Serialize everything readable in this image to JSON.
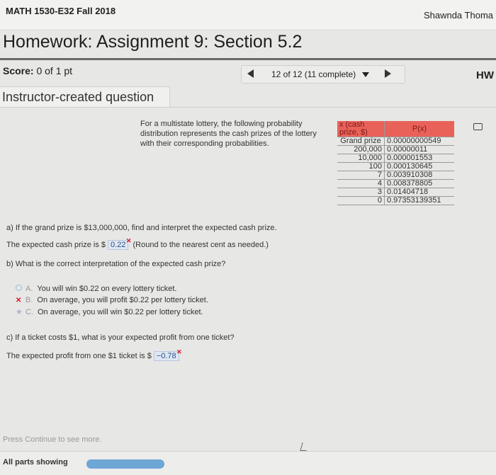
{
  "header": {
    "course": "MATH 1530-E32 Fall 2018",
    "user": "Shawnda Thoma"
  },
  "homework": {
    "title": "Homework: Assignment 9: Section 5.2",
    "score_label": "Score:",
    "score_value": "0 of 1 pt",
    "nav_text": "12 of 12 (11 complete)",
    "badge": "HW"
  },
  "question": {
    "type_label": "Instructor-created question",
    "prompt": "For a multistate lottery, the following probability distribution represents the cash prizes of the lottery with their corresponding probabilities.",
    "table": {
      "headers": [
        "x (cash prize, $)",
        "P(x)"
      ],
      "rows": [
        {
          "x": "Grand prize",
          "p": "0.00000000549"
        },
        {
          "x": "200,000",
          "p": "0.00000011"
        },
        {
          "x": "10,000",
          "p": "0.000001553"
        },
        {
          "x": "100",
          "p": "0.000130645"
        },
        {
          "x": "7",
          "p": "0.003910308"
        },
        {
          "x": "4",
          "p": "0.008378805"
        },
        {
          "x": "3",
          "p": "0.01404718"
        },
        {
          "x": "0",
          "p": "0.97353139351"
        }
      ]
    },
    "part_a": {
      "question": "a) If the grand prize is $13,000,000, find and interpret the expected cash prize.",
      "answer_prefix": "The expected cash prize is $",
      "answer_value": "0.22",
      "answer_suffix": "(Round to the nearest cent as needed.)"
    },
    "part_b": {
      "question": "b) What is the correct interpretation of the expected cash prize?",
      "choices": [
        {
          "letter": "A.",
          "text": "You will win $0.22 on every lottery ticket."
        },
        {
          "letter": "B.",
          "text": "On average, you will profit $0.22 per lottery ticket."
        },
        {
          "letter": "C.",
          "text": "On average, you will win $0.22 per lottery ticket."
        }
      ]
    },
    "part_c": {
      "question": "c) If a ticket costs $1, what is your expected profit from one ticket?",
      "answer_prefix": "The expected profit from one $1 ticket is $",
      "answer_value": "−0.78"
    }
  },
  "footer": {
    "press_continue": "Press Continue to see more.",
    "parts_showing": "All parts showing",
    "progress_fraction": 1.0
  }
}
